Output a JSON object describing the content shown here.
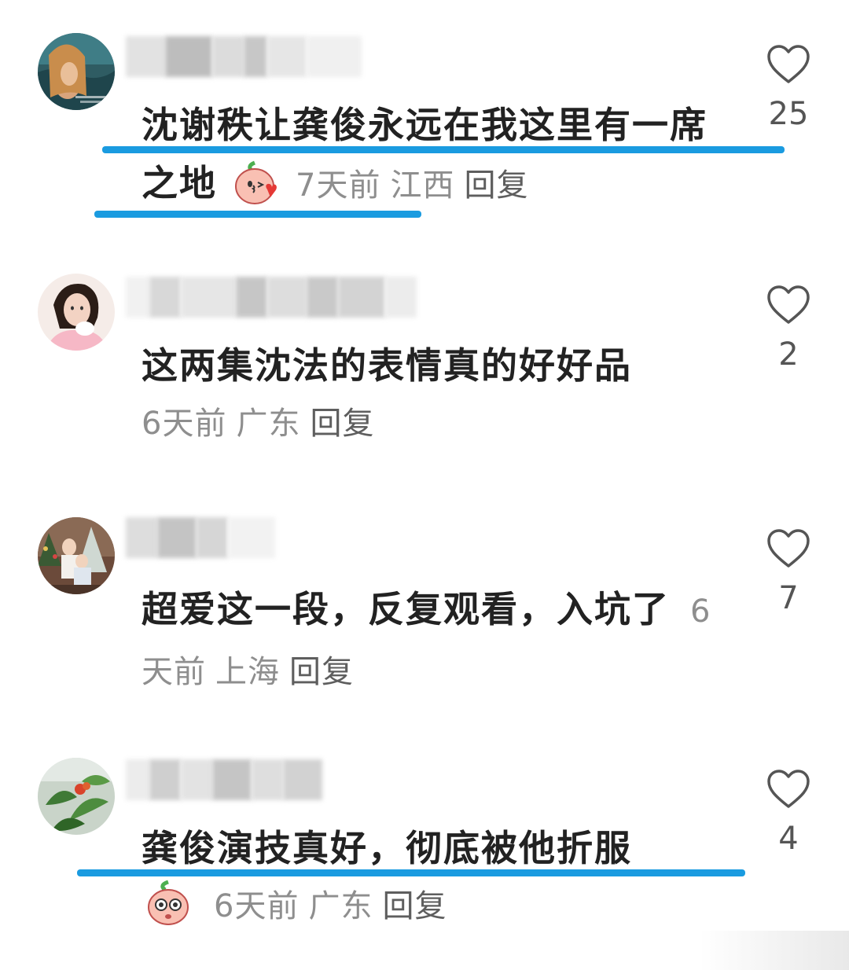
{
  "comments": [
    {
      "text": "沈谢秩让龚俊永远在我这里有一席之地",
      "time": "7天前",
      "location": "江西",
      "reply": "回复",
      "likes": "25",
      "avatar_icon": "ocean-avatar-icon",
      "emoji_icon": "blowing-kiss-peach-emoji-icon"
    },
    {
      "text": "这两集沈法的表情真的好好品",
      "time": "6天前",
      "location": "广东",
      "reply": "回复",
      "likes": "2",
      "avatar_icon": "woman-portrait-avatar-icon"
    },
    {
      "text": "超爱这一段，反复观看，入坑了",
      "time": "6天前",
      "location": "上海",
      "reply": "回复",
      "likes": "7",
      "avatar_icon": "christmas-family-avatar-icon"
    },
    {
      "text": "龚俊演技真好，彻底被他折服",
      "time": "6天前",
      "location": "广东",
      "reply": "回复",
      "likes": "4",
      "avatar_icon": "green-plant-avatar-icon",
      "emoji_icon": "peach-starry-eyes-emoji-icon"
    }
  ],
  "colors": {
    "highlight_underline": "#1a9be0",
    "meta_text": "#8e8e8e",
    "body_text": "#222222"
  }
}
